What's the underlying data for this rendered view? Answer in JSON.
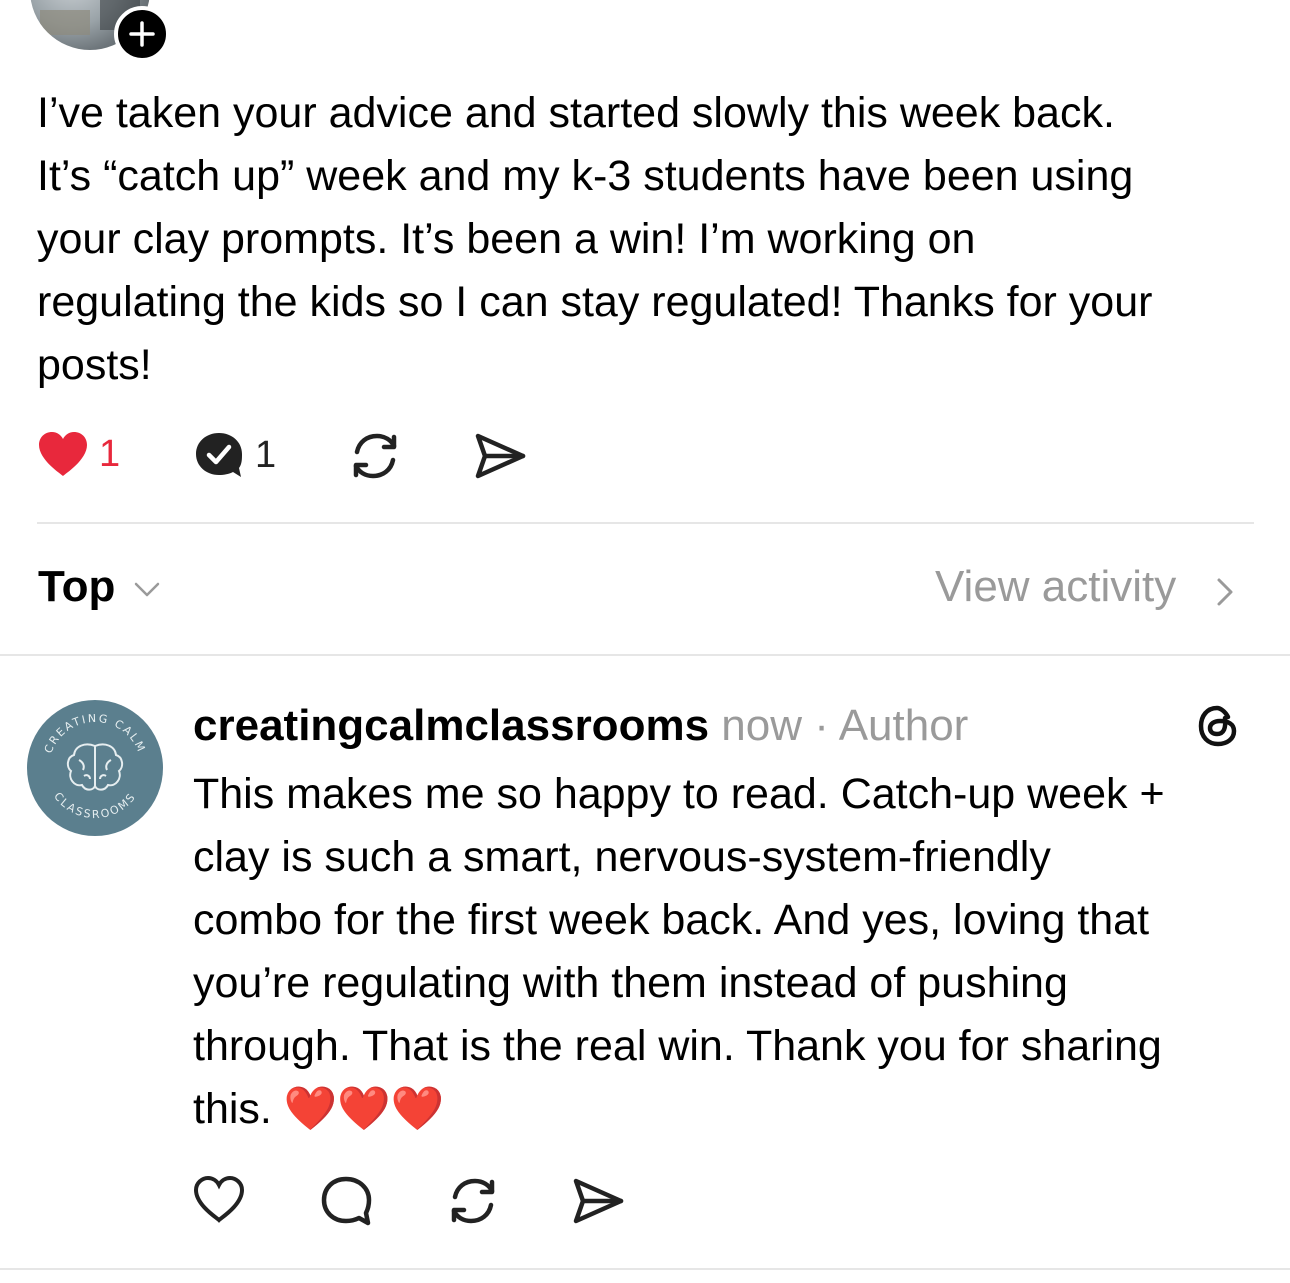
{
  "original_post": {
    "text": "I’ve taken your advice and started slowly this week back.\nIt’s “catch up” week and my k-3 students have been using\nyour clay prompts. It’s been a win! I’m working on\nregulating the kids so I can stay regulated! Thanks for your\nposts!",
    "actions": {
      "like_count": "1",
      "reply_count": "1",
      "liked": true,
      "like_color": "#e8283c"
    }
  },
  "sort_bar": {
    "sort_label": "Top",
    "view_activity_label": "View activity"
  },
  "reply": {
    "avatar_text_top": "CREATING CALM",
    "avatar_text_bottom": "CLASSROOMS",
    "username": "creatingcalmclassrooms",
    "time": "now",
    "separator": " · ",
    "badge": "Author",
    "text": "This makes me so happy to read. Catch-up week +\nclay is such a smart, nervous-system-friendly\ncombo for the first week back. And yes, loving that\nyou’re  regulating with them instead of pushing\nthrough. That is the real win. Thank you for sharing\nthis.",
    "emoji_hearts": "❤️❤️❤️",
    "avatar_color": "#5b7f8e"
  },
  "icons": {
    "like": "heart-icon",
    "reply": "speech-bubble-icon",
    "repost": "repost-icon",
    "share": "send-icon",
    "threads": "threads-logo-icon",
    "add": "plus-icon"
  }
}
